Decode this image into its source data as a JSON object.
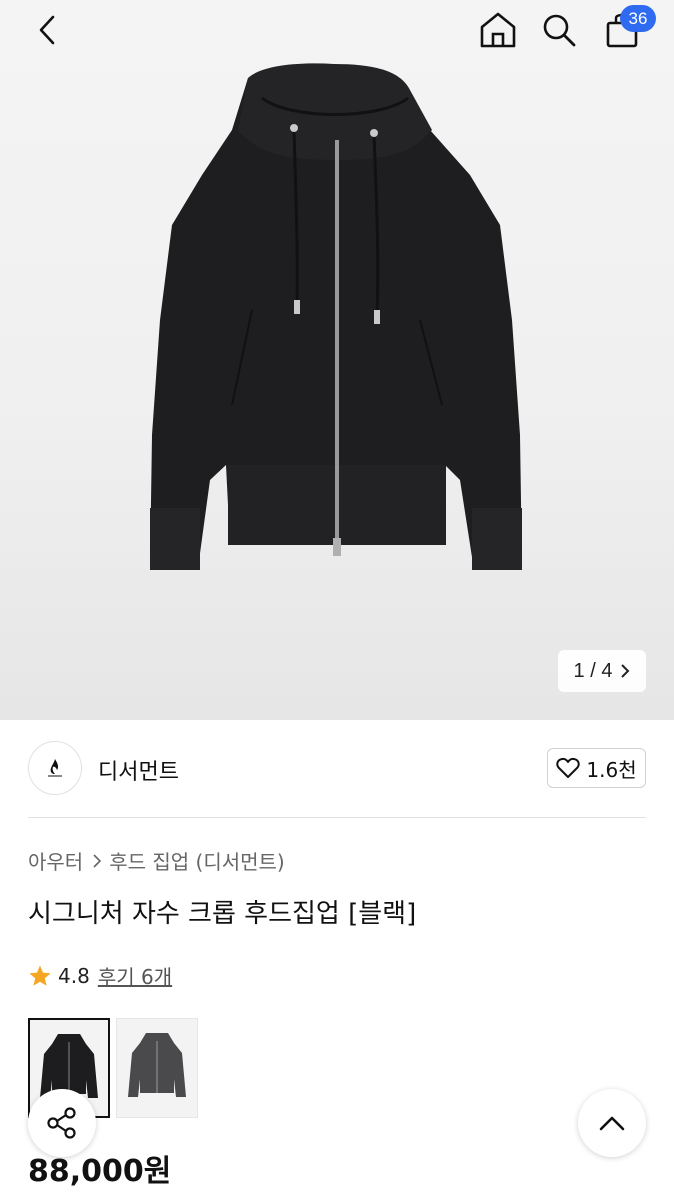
{
  "header": {
    "cart_count": "36",
    "icons": [
      "back-icon",
      "home-icon",
      "search-icon",
      "shopping-bag-icon"
    ]
  },
  "gallery": {
    "pager": "1 / 4",
    "image": "black hooded zip-up jacket"
  },
  "brand": {
    "name": "디서먼트",
    "likes": "1.6천"
  },
  "product": {
    "breadcrumb": [
      "아우터",
      "후드 집업 (디서먼트)"
    ],
    "title": "시그니처 자수 크롭 후드집업 [블랙]",
    "rating": "4.8",
    "reviews": "후기 6개",
    "price": "88,000원",
    "variants": [
      "black",
      "charcoal"
    ]
  },
  "colors": {
    "badge": "#2f6bf0",
    "star": "#f5a623"
  }
}
